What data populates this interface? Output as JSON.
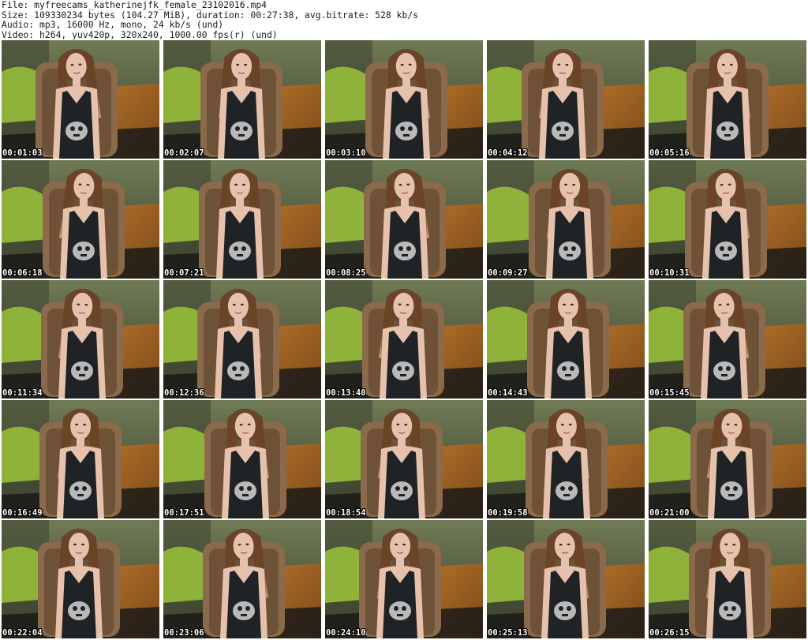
{
  "header": {
    "file_line": "File: myfreecams_katherinejfk_female_23102016.mp4",
    "size_line": "Size: 109330234 bytes (104.27 MiB), duration: 00:27:38, avg.bitrate: 528 kb/s",
    "audio_line": "Audio: mp3, 16000 Hz, mono, 24 kb/s (und)",
    "video_line": "Video: h264, yuv420p, 320x240, 1000.00 fps(r) (und)"
  },
  "colors": {
    "wall": "#6f7a55",
    "wall_shadow": "#3c4330",
    "pillow": "#8fb23a",
    "chair": "#8a6a4a",
    "floor": "#b8742a",
    "floor_dark": "#7a4a1a",
    "hair": "#6b4326",
    "hair_tips": "#c79a6a",
    "skin": "#e6c2ad",
    "top": "#202326",
    "print": "#b9b9b9"
  },
  "thumbnails": [
    {
      "timestamp": "00:01:03"
    },
    {
      "timestamp": "00:02:07"
    },
    {
      "timestamp": "00:03:10"
    },
    {
      "timestamp": "00:04:12"
    },
    {
      "timestamp": "00:05:16"
    },
    {
      "timestamp": "00:06:18"
    },
    {
      "timestamp": "00:07:21"
    },
    {
      "timestamp": "00:08:25"
    },
    {
      "timestamp": "00:09:27"
    },
    {
      "timestamp": "00:10:31"
    },
    {
      "timestamp": "00:11:34"
    },
    {
      "timestamp": "00:12:36"
    },
    {
      "timestamp": "00:13:40"
    },
    {
      "timestamp": "00:14:43"
    },
    {
      "timestamp": "00:15:45"
    },
    {
      "timestamp": "00:16:49"
    },
    {
      "timestamp": "00:17:51"
    },
    {
      "timestamp": "00:18:54"
    },
    {
      "timestamp": "00:19:58"
    },
    {
      "timestamp": "00:21:00"
    },
    {
      "timestamp": "00:22:04"
    },
    {
      "timestamp": "00:23:06"
    },
    {
      "timestamp": "00:24:10"
    },
    {
      "timestamp": "00:25:13"
    },
    {
      "timestamp": "00:26:15"
    }
  ]
}
